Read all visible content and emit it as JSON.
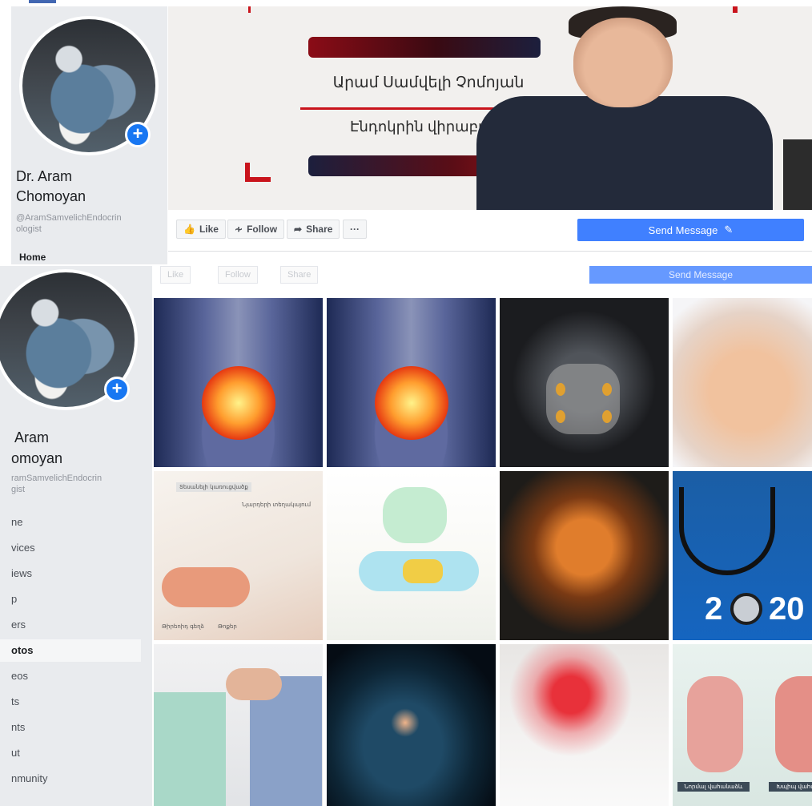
{
  "colors": {
    "facebook_blue": "#4080ff",
    "sidebar_bg": "#e9ebee",
    "badge_blue": "#1877f2",
    "cover_red": "#c9141c"
  },
  "page": {
    "name_line1": "Dr. Aram",
    "name_line2": "Chomoyan",
    "handle_line1": "@AramSamvelichEndocrin",
    "handle_line2": "ologist",
    "home_stub": "Home",
    "plus_icon": "plus-icon"
  },
  "cover": {
    "title": "Արամ Սամվելի Չոմոյան",
    "subtitle": "Էնդոկրին վիրաբույժ"
  },
  "actions": {
    "like": "Like",
    "follow": "Follow",
    "share": "Share",
    "more": "···",
    "send_message": "Send Message"
  },
  "bottom_sidebar": {
    "name_line1": "Aram",
    "name_line2": "omoyan",
    "handle_line1": "ramSamvelichEndocrin",
    "handle_line2": "gist",
    "nav": [
      "ne",
      "vices",
      "iews",
      "p",
      "ers",
      "otos",
      "eos",
      "ts",
      "nts",
      "ut",
      "nmunity"
    ],
    "active_index": 5
  },
  "ghost_bar": {
    "like": "Like",
    "follow": "Follow",
    "share": "Share",
    "send_message": "Send Message"
  },
  "photos": {
    "sketch_labels": [
      "Տեսանելի կառուցվածք",
      "Նյարդերի տեղակայում",
      "Թիրեոիդ գեղձ",
      "Թոքեր"
    ],
    "stetho_text": "2",
    "stetho_text2": "20",
    "goiter_captions": [
      "Նորմալ վահանաձև",
      "Խպիպ վահանաձև"
    ]
  }
}
